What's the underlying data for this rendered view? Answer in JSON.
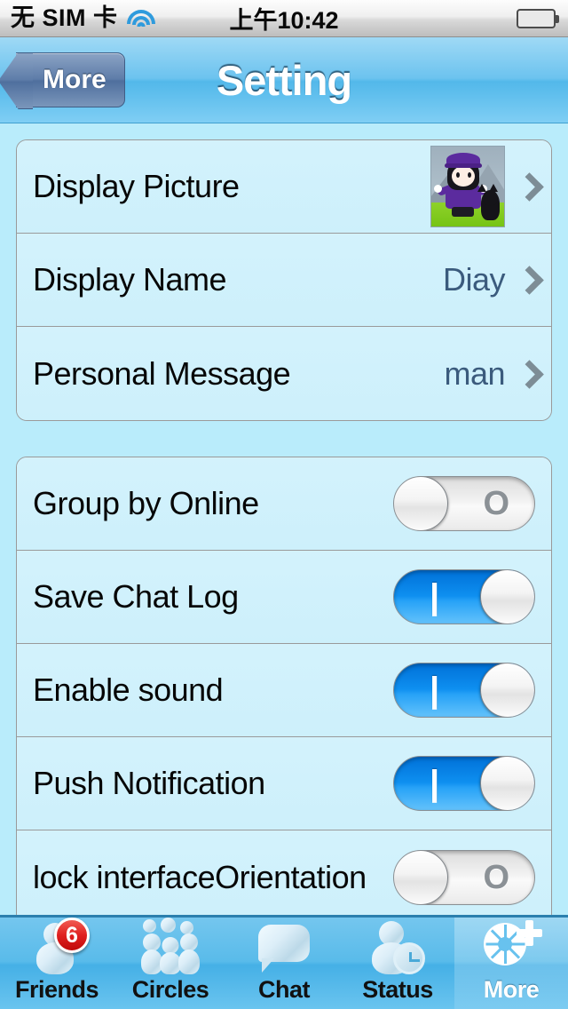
{
  "status_bar": {
    "carrier": "无 SIM 卡",
    "wifi_icon": "wifi-icon",
    "time": "上午10:42",
    "battery_icon": "battery-full-icon"
  },
  "nav_bar": {
    "back_label": "More",
    "title": "Setting"
  },
  "groups": [
    {
      "rows": [
        {
          "label": "Display Picture",
          "type": "disclosure",
          "value": "",
          "thumbnail": "avatar-thumbnail"
        },
        {
          "label": "Display Name",
          "type": "disclosure",
          "value": "Diay"
        },
        {
          "label": "Personal Message",
          "type": "disclosure",
          "value": "man"
        }
      ]
    },
    {
      "rows": [
        {
          "label": "Group by Online",
          "type": "switch",
          "state": "off"
        },
        {
          "label": "Save Chat Log",
          "type": "switch",
          "state": "on"
        },
        {
          "label": "Enable sound",
          "type": "switch",
          "state": "on"
        },
        {
          "label": "Push Notification",
          "type": "switch",
          "state": "on"
        },
        {
          "label": "lock interfaceOrientation",
          "type": "switch",
          "state": "off"
        }
      ]
    }
  ],
  "switch_marks": {
    "on": "|",
    "off": "O"
  },
  "tab_bar": {
    "tabs": [
      {
        "label": "Friends",
        "icon": "person-icon",
        "badge": "6",
        "selected": false
      },
      {
        "label": "Circles",
        "icon": "group-people-icon",
        "badge": "",
        "selected": false
      },
      {
        "label": "Chat",
        "icon": "speech-bubble-icon",
        "badge": "",
        "selected": false
      },
      {
        "label": "Status",
        "icon": "person-clock-icon",
        "badge": "",
        "selected": false
      },
      {
        "label": "More",
        "icon": "wheel-plus-icon",
        "badge": "",
        "selected": true
      }
    ]
  },
  "colors": {
    "page_background": "#b9ecfb",
    "row_background": "#cdf0fb",
    "switch_on": "#0e8ff0",
    "value_text": "#3b5b7d",
    "badge_red": "#e02020",
    "nav_blue": "#6cc3ef"
  }
}
